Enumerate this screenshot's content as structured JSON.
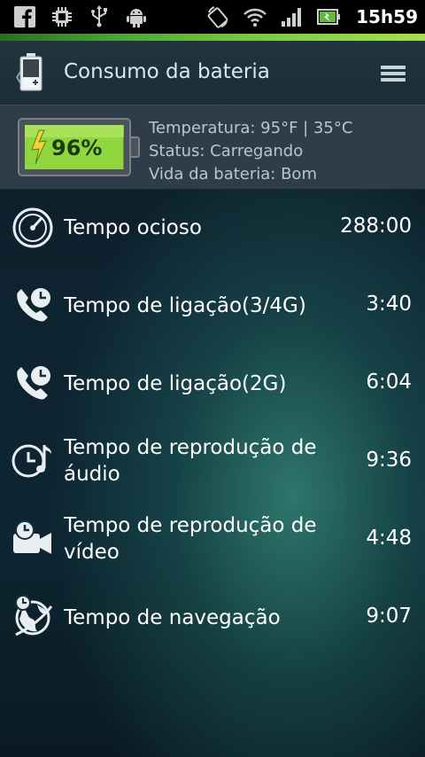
{
  "status_bar": {
    "time": "15h59",
    "icons_left": [
      "facebook-icon",
      "chip-icon",
      "usb-icon",
      "android-debug-icon"
    ],
    "icons_right": [
      "rotate-icon",
      "wifi-icon",
      "signal-icon",
      "battery-charging-icon"
    ]
  },
  "header": {
    "title": "Consumo da bateria"
  },
  "battery": {
    "percent": "96%",
    "level": 0.96,
    "temperature": "Temperatura: 95°F | 35°C",
    "status": "Status: Carregando",
    "health": "Vida da bateria: Bom"
  },
  "items": [
    {
      "label": "Tempo ocioso",
      "value": "288:00",
      "icon": "gauge-icon"
    },
    {
      "label": "Tempo de ligação(3/4G)",
      "value": "3:40",
      "icon": "phone-clock-icon"
    },
    {
      "label": "Tempo de ligação(2G)",
      "value": "6:04",
      "icon": "phone-clock-icon"
    },
    {
      "label_line1": "Tempo de reprodução de",
      "label_line2": "áudio",
      "value": "9:36",
      "icon": "music-clock-icon"
    },
    {
      "label_line1": "Tempo de reprodução de",
      "label_line2": "vídeo",
      "value": "4:48",
      "icon": "video-clock-icon"
    },
    {
      "label": "Tempo de navegação",
      "value": "9:07",
      "icon": "globe-clock-icon"
    }
  ],
  "colors": {
    "accent_green": "#8fd63f",
    "panel": "#2e3d49",
    "header": "#1d323c"
  }
}
